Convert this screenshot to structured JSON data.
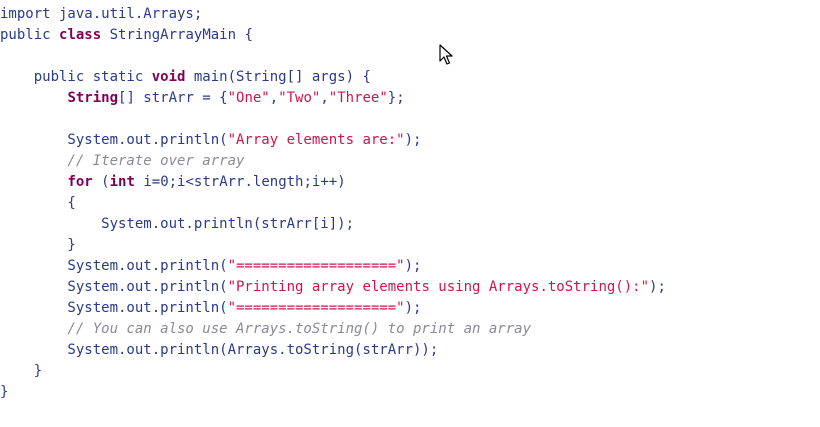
{
  "code_lines": [
    [
      {
        "t": "import java.util.Arrays;",
        "c": "plain"
      }
    ],
    [
      {
        "t": "public ",
        "c": "plain"
      },
      {
        "t": "class",
        "c": "kw"
      },
      {
        "t": " StringArrayMain {",
        "c": "plain"
      }
    ],
    [],
    [
      {
        "t": "    public static ",
        "c": "plain"
      },
      {
        "t": "void",
        "c": "kw"
      },
      {
        "t": " main(String[] args) {",
        "c": "plain"
      }
    ],
    [
      {
        "t": "        ",
        "c": "plain"
      },
      {
        "t": "String",
        "c": "kw"
      },
      {
        "t": "[] strArr = {",
        "c": "plain"
      },
      {
        "t": "\"One\"",
        "c": "str"
      },
      {
        "t": ",",
        "c": "plain"
      },
      {
        "t": "\"Two\"",
        "c": "str"
      },
      {
        "t": ",",
        "c": "plain"
      },
      {
        "t": "\"Three\"",
        "c": "str"
      },
      {
        "t": "};",
        "c": "plain"
      }
    ],
    [],
    [
      {
        "t": "        System.out.println(",
        "c": "plain"
      },
      {
        "t": "\"Array elements are:\"",
        "c": "str"
      },
      {
        "t": ");",
        "c": "plain"
      }
    ],
    [
      {
        "t": "        // Iterate over array",
        "c": "cmt"
      }
    ],
    [
      {
        "t": "        ",
        "c": "plain"
      },
      {
        "t": "for",
        "c": "kw"
      },
      {
        "t": " (",
        "c": "plain"
      },
      {
        "t": "int",
        "c": "kw"
      },
      {
        "t": " i=",
        "c": "plain"
      },
      {
        "t": "0",
        "c": "num"
      },
      {
        "t": ";i<strArr.length;i++)",
        "c": "plain"
      }
    ],
    [
      {
        "t": "        {",
        "c": "plain"
      }
    ],
    [
      {
        "t": "            System.out.println(strArr[i]);",
        "c": "plain"
      }
    ],
    [
      {
        "t": "        }",
        "c": "plain"
      }
    ],
    [
      {
        "t": "        System.out.println(",
        "c": "plain"
      },
      {
        "t": "\"===================\"",
        "c": "str"
      },
      {
        "t": ");",
        "c": "plain"
      }
    ],
    [
      {
        "t": "        System.out.println(",
        "c": "plain"
      },
      {
        "t": "\"Printing array elements using Arrays.toString():\"",
        "c": "str"
      },
      {
        "t": ");",
        "c": "plain"
      }
    ],
    [
      {
        "t": "        System.out.println(",
        "c": "plain"
      },
      {
        "t": "\"===================\"",
        "c": "str"
      },
      {
        "t": ");",
        "c": "plain"
      }
    ],
    [
      {
        "t": "        // You can also use Arrays.toString() to print an array",
        "c": "cmt"
      }
    ],
    [
      {
        "t": "        System.out.println(Arrays.toString(strArr));",
        "c": "plain"
      }
    ],
    [
      {
        "t": "    }",
        "c": "plain"
      }
    ],
    [
      {
        "t": "}",
        "c": "plain"
      }
    ]
  ],
  "colors": {
    "keyword": "#7f0055",
    "plain": "#2a3a8c",
    "string": "#d3134b",
    "comment": "#8a8a9a",
    "background": "#ffffff"
  },
  "cursor_icon": "arrow-cursor-icon"
}
